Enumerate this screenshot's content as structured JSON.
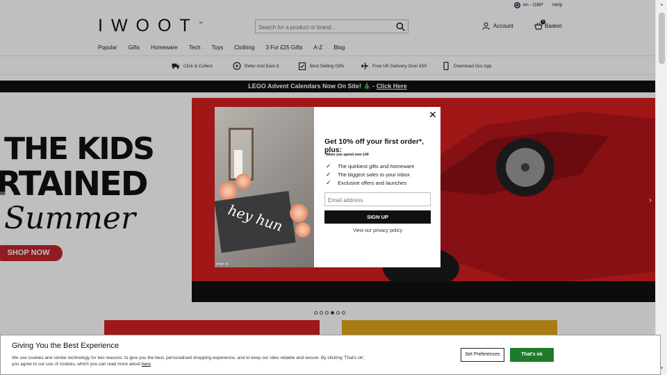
{
  "topbar": {
    "locale": "en - GBP",
    "help": "Help"
  },
  "header": {
    "logo": "IWOOT",
    "logo_tm": "™",
    "search_placeholder": "Search for a product or brand...",
    "account": "Account",
    "basket": "Basket",
    "basket_count": "0"
  },
  "nav": [
    "Popular",
    "Gifts",
    "Homeware",
    "Tech",
    "Toys",
    "Clothing",
    "3 For £25 Gifts",
    "A-Z",
    "Blog"
  ],
  "benefits": [
    {
      "label": "Click & Collect",
      "icon": "truck-icon"
    },
    {
      "label": "Refer And Earn £",
      "icon": "refer-icon"
    },
    {
      "label": "Best Selling Gifts",
      "icon": "clipboard-icon"
    },
    {
      "label": "Free UK Delivery Over £50",
      "icon": "plane-icon"
    },
    {
      "label": "Download Our App",
      "icon": "phone-icon"
    }
  ],
  "announcement": {
    "text": "LEGO Advent Calendars Now On Site! 🎄 - ",
    "link": "Click Here"
  },
  "hero": {
    "line1": "THE KIDS",
    "line2": "RTAINED",
    "line3": "Summer",
    "cta": "SHOP NOW",
    "prev": "‹",
    "next": "›"
  },
  "carousel": {
    "slides": 6,
    "active": 3
  },
  "modal": {
    "close": "✕",
    "title": "Get 10% off your first order*, plus:",
    "subtitle": "*When you spend over £40",
    "perks": [
      "The quirkiest gifts and homeware",
      "The biggest sales to your inbox",
      "Exclusive offers and launches"
    ],
    "email_placeholder": "Email address",
    "signup": "SIGN UP",
    "privacy": "View our privacy policy",
    "image_text": "hey hun",
    "photo_credit": "Image: @..."
  },
  "cookie": {
    "title": "Giving You the Best Experience",
    "text": "We use cookies and similar technology for two reasons: to give you the best, personalised shopping experience, and to keep our sites reliable and secure. By clicking 'That's ok', you agree to our use of cookies, which you can read more about ",
    "link": "here",
    "set_preferences": "Set Preferences",
    "accept": "That's ok"
  },
  "colors": {
    "accent_red": "#c0262d",
    "hero_red": "#d41f1f",
    "accept_green": "#1f7a2c",
    "tile_yellow": "#e0a51a"
  }
}
